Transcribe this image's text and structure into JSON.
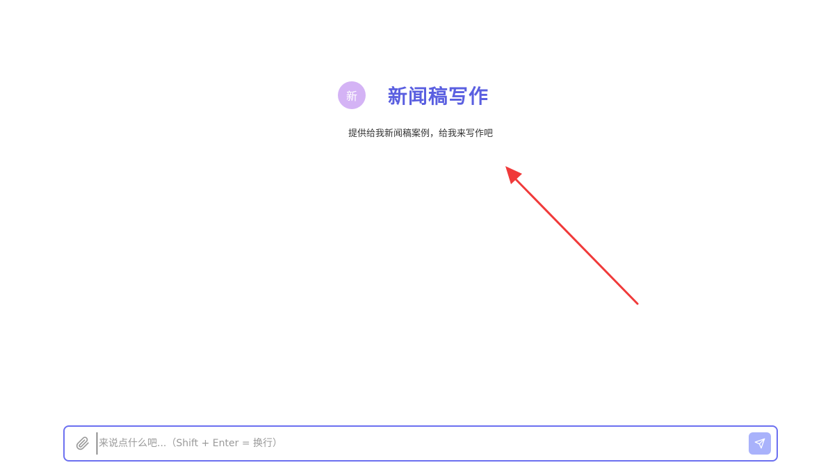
{
  "app": {
    "avatar_text": "新",
    "title": "新闻稿写作",
    "subtitle": "提供给我新闻稿案例，给我来写作吧"
  },
  "composer": {
    "placeholder": "来说点什么吧...（Shift + Enter = 换行）",
    "value": ""
  },
  "icons": {
    "attach": "paperclip-icon",
    "send": "send-icon"
  },
  "colors": {
    "accent": "#6b6ff0",
    "title": "#5a5fe0",
    "avatar_bg": "#d4b3f5",
    "send_bg": "#a9b2fb",
    "annotation_arrow": "#f03a3a"
  }
}
